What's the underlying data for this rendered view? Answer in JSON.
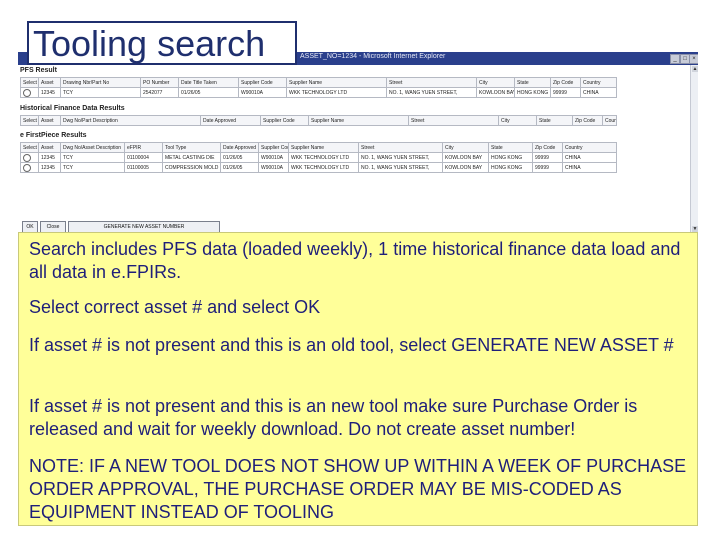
{
  "slide_title": "Tooling search",
  "window": {
    "title": "ASSET_NO=1234 - Microsoft Internet Explorer",
    "minimize_label": "_",
    "maximize_label": "□",
    "close_label": "×"
  },
  "pfs": {
    "section_title": "PFS Result",
    "headers": [
      "Select",
      "Asset",
      "Drawing Nbr/Part No",
      "PO Number",
      "Date Title Taken",
      "Supplier Code",
      "Supplier Name",
      "Street",
      "City",
      "State",
      "Zip Code",
      "Country"
    ],
    "rows": [
      [
        "",
        "12345",
        "TCY",
        "2542077",
        "01/26/05",
        "W90010A",
        "WKK TECHNOLOGY LTD",
        "NO. 1, WANG YUEN STREET,",
        "KOWLOON BAY",
        "HONG KONG",
        "99999",
        "CHINA"
      ]
    ]
  },
  "historical": {
    "section_title": "Historical Finance Data Results",
    "headers": [
      "Select",
      "Asset",
      "Dwg No/Part Description",
      "Date Approved",
      "Supplier Code",
      "Supplier Name",
      "Street",
      "City",
      "State",
      "Zip Code",
      "Country"
    ],
    "rows": []
  },
  "efpir": {
    "section_title": "e FirstPiece Results",
    "headers": [
      "Select",
      "Asset",
      "Dwg No/Asset Description",
      "eFPIR",
      "Tool Type",
      "Date Approved",
      "Supplier Code",
      "Supplier Name",
      "Street",
      "City",
      "State",
      "Zip Code",
      "Country"
    ],
    "rows": [
      [
        "",
        "12345",
        "TCY",
        "01100004",
        "METAL CASTING DIE",
        "01/26/05",
        "W90010A",
        "WKK TECHNOLOGY LTD",
        "NO. 1, WANG YUEN STREET,",
        "KOWLOON BAY",
        "HONG KONG",
        "99999",
        "CHINA"
      ],
      [
        "",
        "12345",
        "TCY",
        "01100005",
        "COMPRESSION MOLD",
        "01/26/05",
        "W90010A",
        "WKK TECHNOLOGY LTD",
        "NO. 1, WANG YUEN STREET,",
        "KOWLOON BAY",
        "HONG KONG",
        "99999",
        "CHINA"
      ]
    ]
  },
  "buttons": {
    "ok": "OK",
    "close": "Close",
    "generate": "GENERATE NEW ASSET NUMBER"
  },
  "notes": [
    "Search includes PFS data (loaded weekly), 1 time historical finance data load and all data in e.FPIRs.",
    "Select correct asset # and select OK",
    "If asset # is not present and this is an old tool, select GENERATE NEW ASSET #",
    "If asset # is not present and this is an new tool make sure Purchase Order is released and wait for weekly download.  Do not create asset number!",
    "NOTE: IF A NEW TOOL DOES NOT SHOW UP WITHIN A WEEK OF PURCHASE ORDER APPROVAL, THE PURCHASE ORDER MAY BE MIS-CODED AS EQUIPMENT INSTEAD OF TOOLING"
  ],
  "colors": {
    "title_color": "#1f2f6e",
    "note_bg": "#ffff99",
    "note_text": "#1f1f7a",
    "titlebar": "#2a3f8c"
  }
}
